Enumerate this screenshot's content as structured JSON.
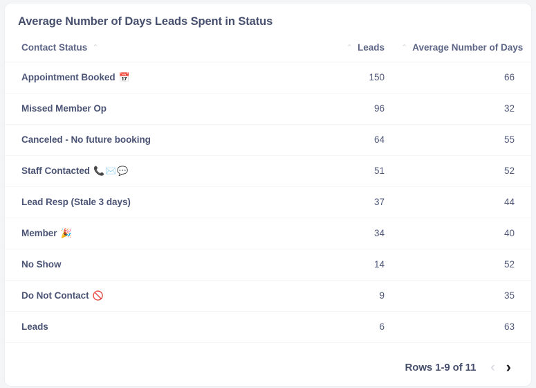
{
  "card": {
    "title": "Average Number of Days Leads Spent in Status"
  },
  "table": {
    "columns": [
      {
        "label": "Contact Status",
        "sort_icon": "chevron-up-icon",
        "sort_glyph": "⌃"
      },
      {
        "label": "Leads",
        "sort_icon": "chevron-up-icon",
        "sort_glyph": "⌃"
      },
      {
        "label": "Average Number of Days",
        "sort_icon": "chevron-up-icon",
        "sort_glyph": "⌃"
      }
    ],
    "rows": [
      {
        "status": "Appointment Booked",
        "emoji": "📅",
        "emoji_name": "calendar-icon",
        "leads": "150",
        "days": "66"
      },
      {
        "status": "Missed Member Op",
        "emoji": "",
        "emoji_name": "",
        "leads": "96",
        "days": "32"
      },
      {
        "status": "Canceled - No future booking",
        "emoji": "",
        "emoji_name": "",
        "leads": "64",
        "days": "55"
      },
      {
        "status": "Staff Contacted",
        "emoji": "📞✉️💬",
        "emoji_name": "phone-envelope-speech-icons",
        "leads": "51",
        "days": "52"
      },
      {
        "status": "Lead Resp (Stale 3 days)",
        "emoji": "",
        "emoji_name": "",
        "leads": "37",
        "days": "44"
      },
      {
        "status": "Member",
        "emoji": "🎉",
        "emoji_name": "party-popper-icon",
        "leads": "34",
        "days": "40"
      },
      {
        "status": "No Show",
        "emoji": "",
        "emoji_name": "",
        "leads": "14",
        "days": "52"
      },
      {
        "status": "Do Not Contact",
        "emoji": "🚫",
        "emoji_name": "prohibited-icon",
        "leads": "9",
        "days": "35"
      },
      {
        "status": "Leads",
        "emoji": "",
        "emoji_name": "",
        "leads": "6",
        "days": "63"
      }
    ]
  },
  "footer": {
    "rows_label": "Rows 1-9 of 11",
    "prev_glyph": "‹",
    "next_glyph": "›",
    "prev_enabled": false,
    "next_enabled": true
  },
  "colors": {
    "page_background": "#f4f5f7",
    "card_background": "#ffffff",
    "text_primary": "#464f6d",
    "text_body": "#4b5475",
    "header_text": "#5d6586",
    "divider": "#f4f5f7",
    "sort_icon": "#d3d6dd",
    "pager_disabled": "#cdd1d9",
    "pager_enabled": "#16181d"
  }
}
